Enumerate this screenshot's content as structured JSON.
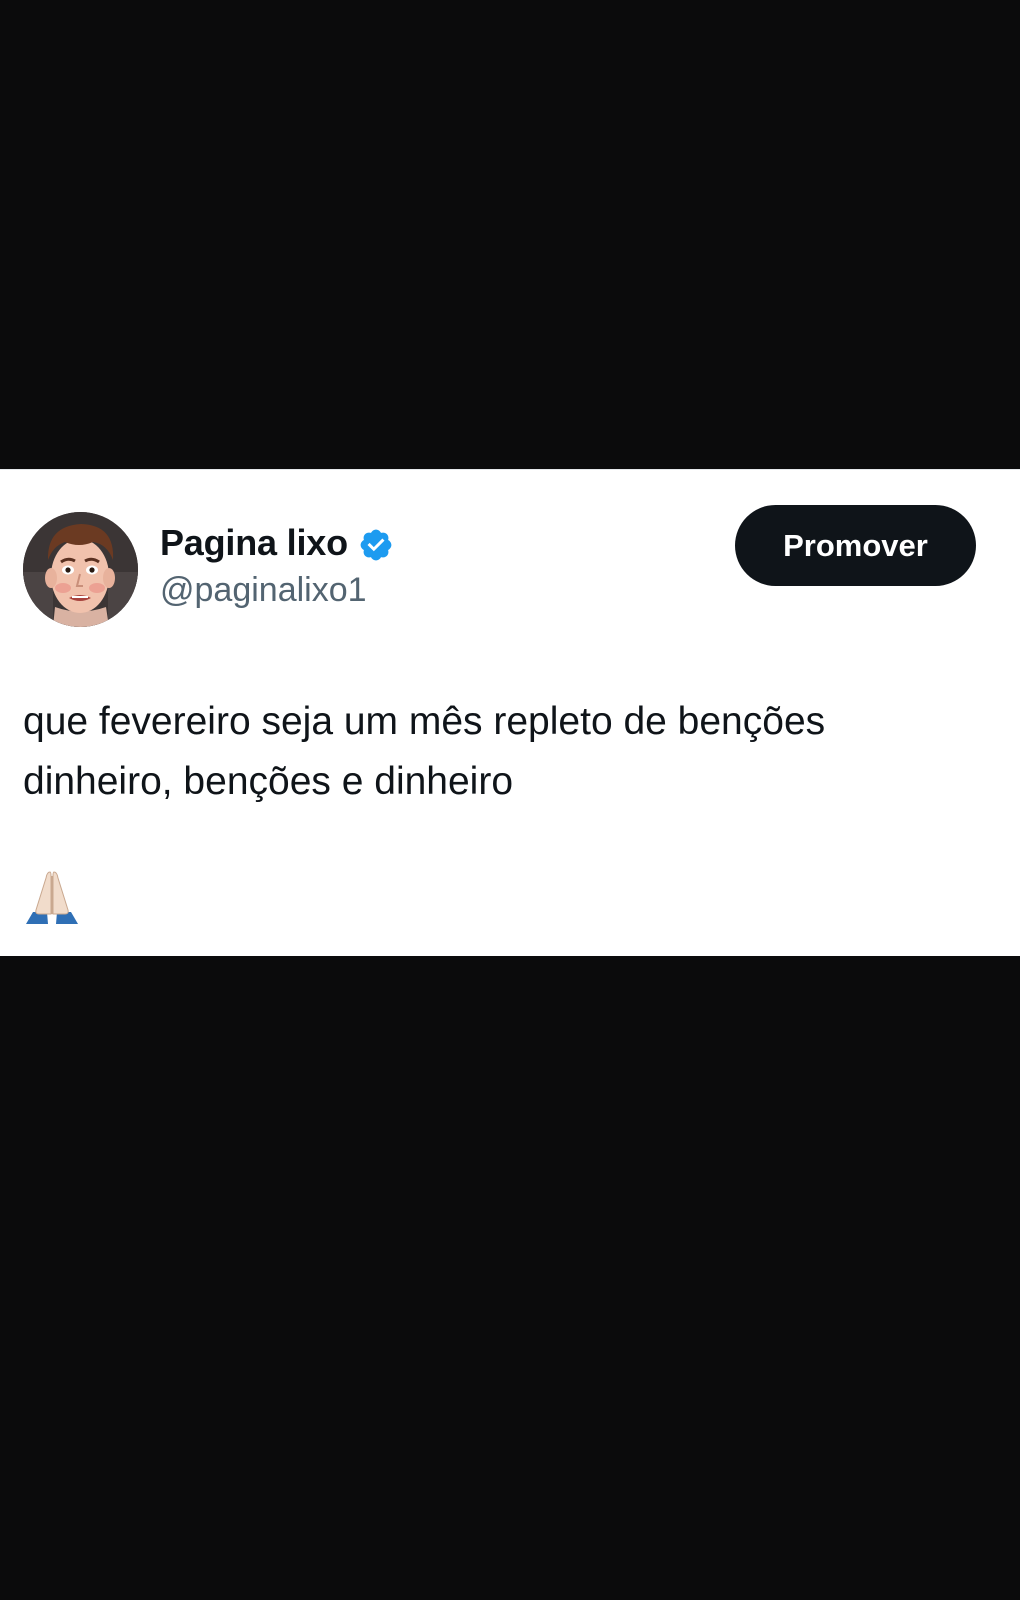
{
  "tweet": {
    "author": {
      "display_name": "Pagina lixo",
      "handle": "@paginalixo1",
      "verified": true,
      "avatar_icon": "cartoon-face-avatar",
      "verified_color": "#1d9bf0"
    },
    "promote_button": {
      "label": "Promover"
    },
    "text_lines": [
      "que fevereiro seja um mês repleto de benções",
      "dinheiro, benções e dinheiro"
    ],
    "emoji": {
      "name": "folded-hands-emoji"
    }
  },
  "colors": {
    "background": "#0b0b0c",
    "card": "#ffffff",
    "text": "#0f1419",
    "secondary_text": "#536471",
    "button": "#0f1419"
  }
}
